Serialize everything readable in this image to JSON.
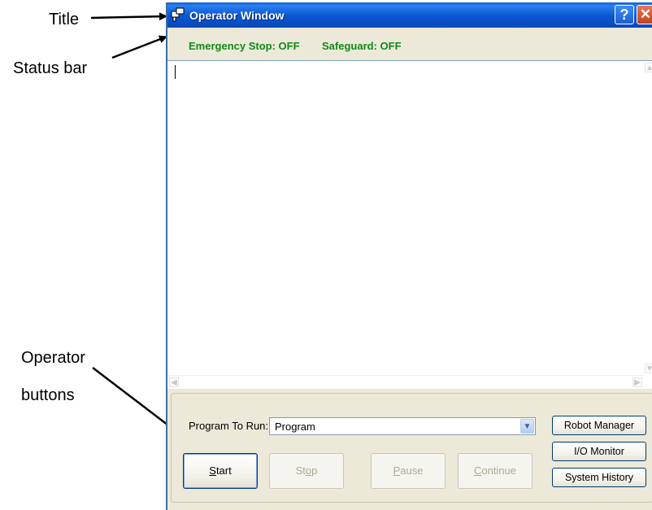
{
  "annotations": {
    "title": "Title",
    "status_bar": "Status bar",
    "operator_line1": "Operator",
    "operator_line2": "buttons"
  },
  "window": {
    "title": "Operator Window",
    "icon": "operator-window-icon",
    "help_label": "?",
    "close_label": "✕"
  },
  "status": {
    "emergency_stop": "Emergency Stop: OFF",
    "safeguard": "Safeguard: OFF",
    "color": "#108a1a"
  },
  "program": {
    "label": "Program To Run:",
    "selected": "Program"
  },
  "buttons": {
    "start": {
      "label": "Start",
      "accel": "S",
      "rest": "tart",
      "enabled": true
    },
    "stop": {
      "label": "Stop",
      "accel": "o",
      "pre": "St",
      "rest": "p",
      "enabled": false
    },
    "pause": {
      "label": "Pause",
      "accel": "P",
      "rest": "ause",
      "enabled": false
    },
    "continue": {
      "label": "Continue",
      "accel": "C",
      "rest": "ontinue",
      "enabled": false
    },
    "robot_manager": "Robot Manager",
    "io_monitor": "I/O Monitor",
    "system_history": "System History"
  },
  "colors": {
    "titlebar": "#0a56d0",
    "window_bg": "#ece9d8",
    "status_text": "#108a1a"
  }
}
